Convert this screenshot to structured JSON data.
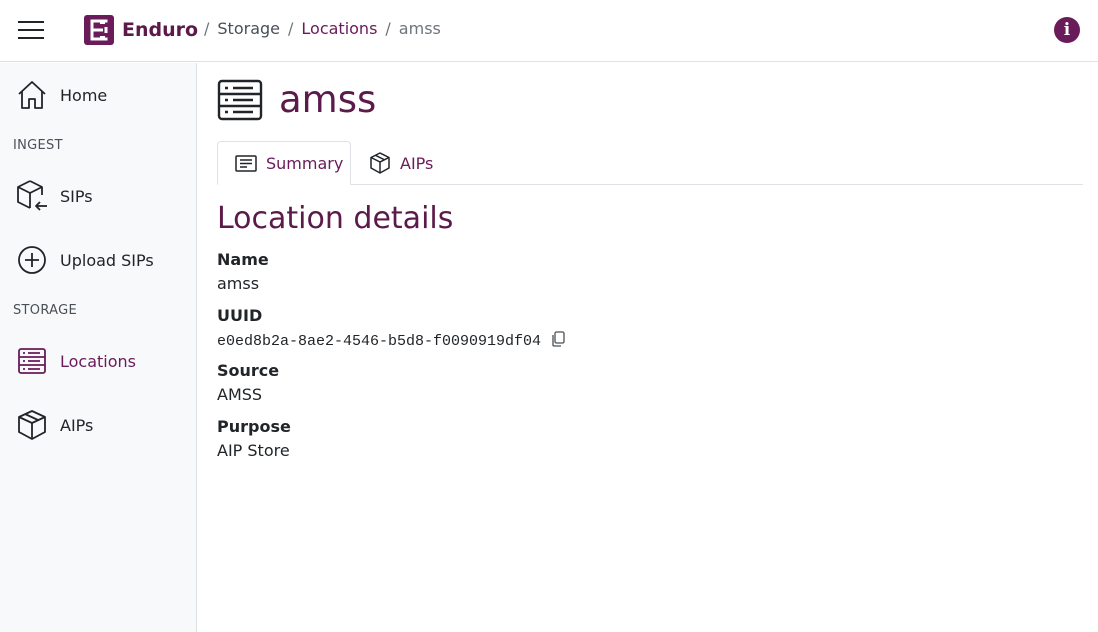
{
  "header": {
    "brand_name": "Enduro",
    "breadcrumb": [
      "Storage",
      "Locations",
      "amss"
    ],
    "separator": "/"
  },
  "sidebar": {
    "home_label": "Home",
    "section_ingest": "INGEST",
    "sips_label": "SIPs",
    "upload_sips_label": "Upload SIPs",
    "section_storage": "STORAGE",
    "locations_label": "Locations",
    "aips_label": "AIPs"
  },
  "page": {
    "title": "amss",
    "tabs": [
      {
        "label": "Summary",
        "active": true,
        "icon": "list-icon"
      },
      {
        "label": "AIPs",
        "active": false,
        "icon": "box-icon"
      }
    ],
    "section_title": "Location details",
    "details": {
      "name_label": "Name",
      "name_value": "amss",
      "uuid_label": "UUID",
      "uuid_value": "e0ed8b2a-8ae2-4546-b5d8-f0090919df04",
      "source_label": "Source",
      "source_value": "AMSS",
      "purpose_label": "Purpose",
      "purpose_value": "AIP Store"
    }
  },
  "colors": {
    "brand": "#6a1b5a",
    "title": "#5b1a4a",
    "sidebar_bg": "#f8f9fa",
    "border": "#dee2e6"
  }
}
